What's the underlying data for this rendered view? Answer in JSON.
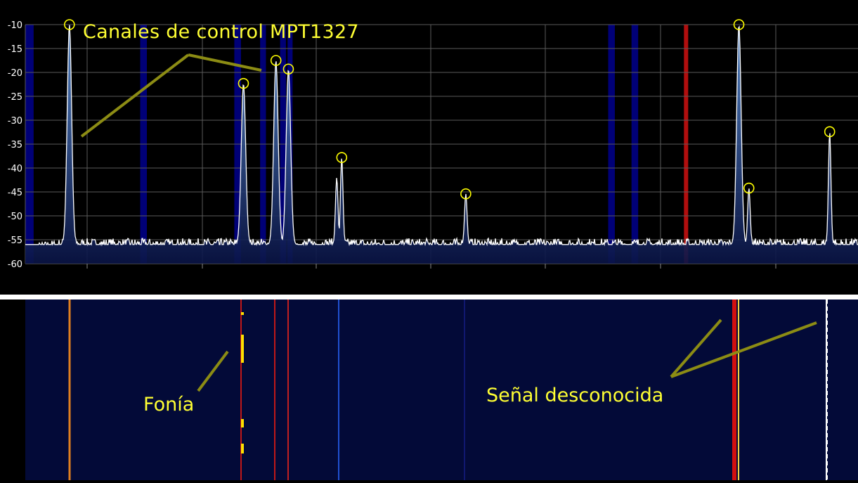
{
  "chart_data": {
    "type": "line",
    "title": "",
    "xlabel": "",
    "ylabel": "",
    "ylim": [
      -60,
      -10
    ],
    "yticks": [
      -10,
      -15,
      -20,
      -25,
      -30,
      -35,
      -40,
      -45,
      -50,
      -55,
      -60
    ],
    "grid": true,
    "noise_floor_db": -56,
    "peaks": [
      {
        "id": "p1",
        "x_frac": 0.053,
        "level_db": -10,
        "marked": true
      },
      {
        "id": "p2",
        "x_frac": 0.262,
        "level_db": -22.3,
        "marked": true
      },
      {
        "id": "p3",
        "x_frac": 0.301,
        "level_db": -17.5,
        "marked": true
      },
      {
        "id": "p4",
        "x_frac": 0.316,
        "level_db": -19.3,
        "marked": true
      },
      {
        "id": "p5a",
        "x_frac": 0.374,
        "level_db": -42,
        "marked": false
      },
      {
        "id": "p5",
        "x_frac": 0.38,
        "level_db": -37.8,
        "marked": true
      },
      {
        "id": "p6",
        "x_frac": 0.529,
        "level_db": -45.4,
        "marked": true
      },
      {
        "id": "p7",
        "x_frac": 0.857,
        "level_db": -10,
        "marked": true
      },
      {
        "id": "p8",
        "x_frac": 0.869,
        "level_db": -44.2,
        "marked": true
      },
      {
        "id": "p9",
        "x_frac": 0.966,
        "level_db": -32.4,
        "marked": true
      }
    ],
    "colors": {
      "trace": "#ffffff",
      "fill_top": "#5a8fd6",
      "fill_bottom": "#0a1446",
      "grid": "#5a5a5a",
      "marker": "#ffff00",
      "highlight_band": "#00008c",
      "red_marker": "#d01010",
      "waterfall_bg": "#030a38"
    }
  },
  "annotations": {
    "control_channels": "Canales de control MPT1327",
    "voice": "Fonía",
    "unknown_signal": "Señal desconocida"
  },
  "colors": {
    "annotation_text": "#ffff33",
    "leader_line": "#8c8c14"
  }
}
